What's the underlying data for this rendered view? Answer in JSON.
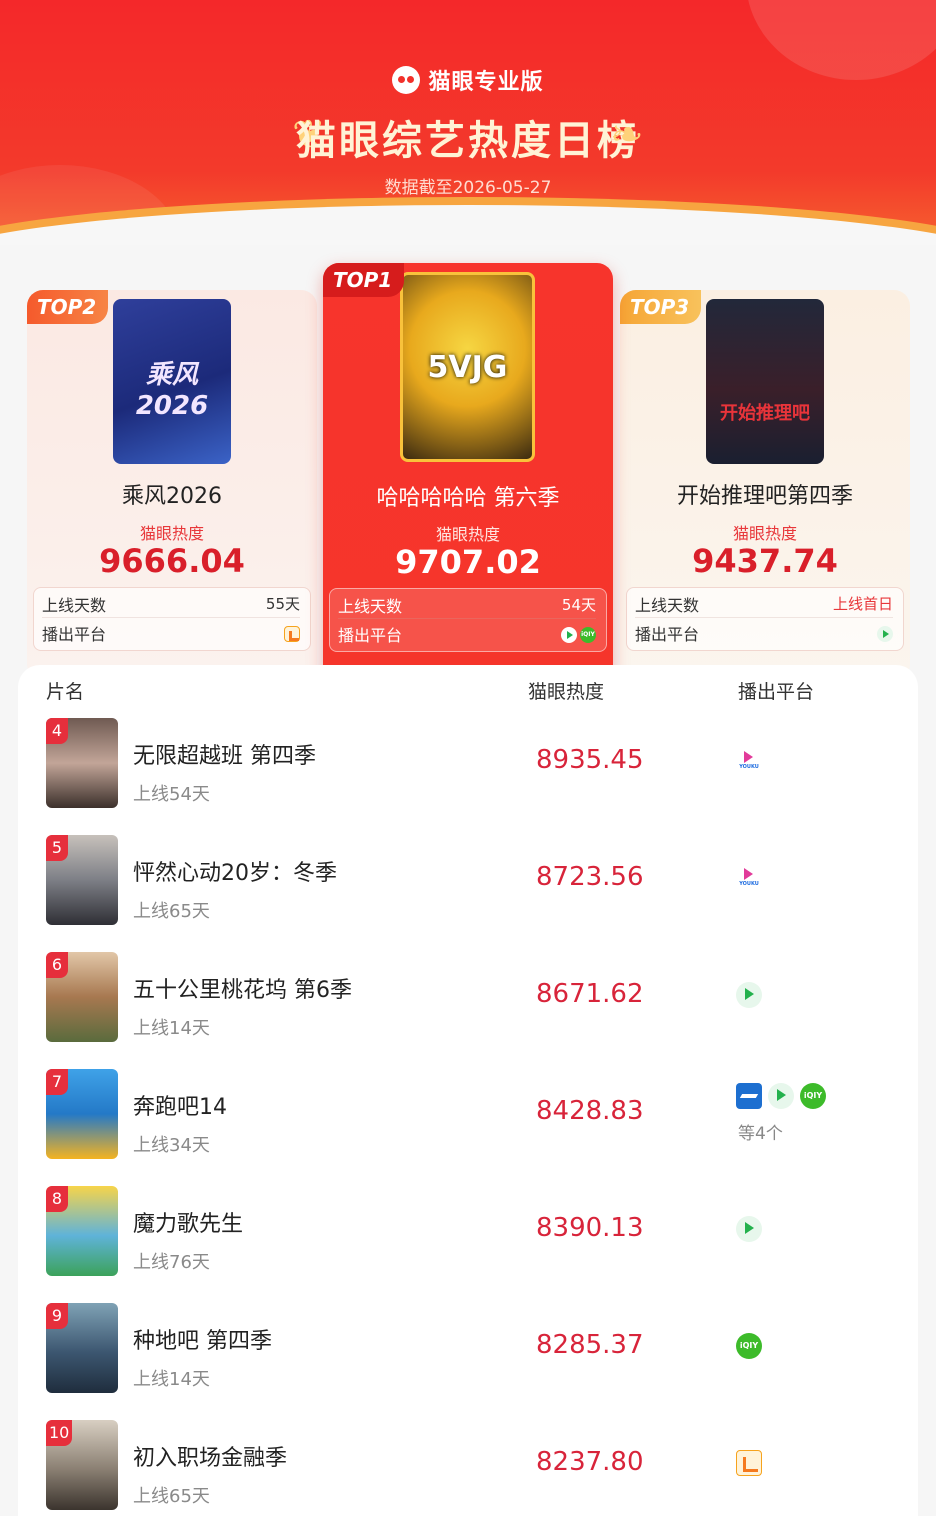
{
  "header": {
    "brand": "猫眼专业版",
    "title": "猫眼综艺热度日榜",
    "date_line": "数据截至2026-05-27"
  },
  "top3": [
    {
      "rank_label": "TOP2",
      "title": "乘风2026",
      "heat_label": "猫眼热度",
      "heat": "9666.04",
      "days_label": "上线天数",
      "days": "55天",
      "platform_label": "播出平台",
      "poster_text": "乘风 2026",
      "platforms": [
        "mango-tv-icon"
      ]
    },
    {
      "rank_label": "TOP1",
      "title": "哈哈哈哈哈 第六季",
      "heat_label": "猫眼热度",
      "heat": "9707.02",
      "days_label": "上线天数",
      "days": "54天",
      "platform_label": "播出平台",
      "poster_text": "5VJG",
      "platforms": [
        "tencent-video-icon",
        "iqiyi-icon"
      ]
    },
    {
      "rank_label": "TOP3",
      "title": "开始推理吧第四季",
      "heat_label": "猫眼热度",
      "heat": "9437.74",
      "days_label": "上线天数",
      "days": "上线首日",
      "platform_label": "播出平台",
      "poster_text": "开始推理吧",
      "platforms": [
        "tencent-video-icon"
      ]
    }
  ],
  "list": {
    "headers": {
      "name": "片名",
      "heat": "猫眼热度",
      "platform": "播出平台"
    },
    "rows": [
      {
        "rank": "4",
        "title": "无限超越班 第四季",
        "sub": "上线54天",
        "heat": "8935.45",
        "platforms": [
          "youku-icon"
        ],
        "more": ""
      },
      {
        "rank": "5",
        "title": "怦然心动20岁：冬季",
        "sub": "上线65天",
        "heat": "8723.56",
        "platforms": [
          "youku-icon"
        ],
        "more": ""
      },
      {
        "rank": "6",
        "title": "五十公里桃花坞 第6季",
        "sub": "上线14天",
        "heat": "8671.62",
        "platforms": [
          "tencent-video-icon"
        ],
        "more": ""
      },
      {
        "rank": "7",
        "title": "奔跑吧14",
        "sub": "上线34天",
        "heat": "8428.83",
        "platforms": [
          "zhejiang-tv-icon",
          "tencent-video-icon",
          "iqiyi-icon"
        ],
        "more": "等4个"
      },
      {
        "rank": "8",
        "title": "魔力歌先生",
        "sub": "上线76天",
        "heat": "8390.13",
        "platforms": [
          "tencent-video-icon"
        ],
        "more": ""
      },
      {
        "rank": "9",
        "title": "种地吧 第四季",
        "sub": "上线14天",
        "heat": "8285.37",
        "platforms": [
          "iqiyi-icon"
        ],
        "more": ""
      },
      {
        "rank": "10",
        "title": "初入职场金融季",
        "sub": "上线65天",
        "heat": "8237.80",
        "platforms": [
          "mango-tv-icon"
        ],
        "more": ""
      }
    ]
  },
  "colors": {
    "brand_red": "#f4282a",
    "heat_red": "#d8243a",
    "gold": "#f9c23b"
  }
}
